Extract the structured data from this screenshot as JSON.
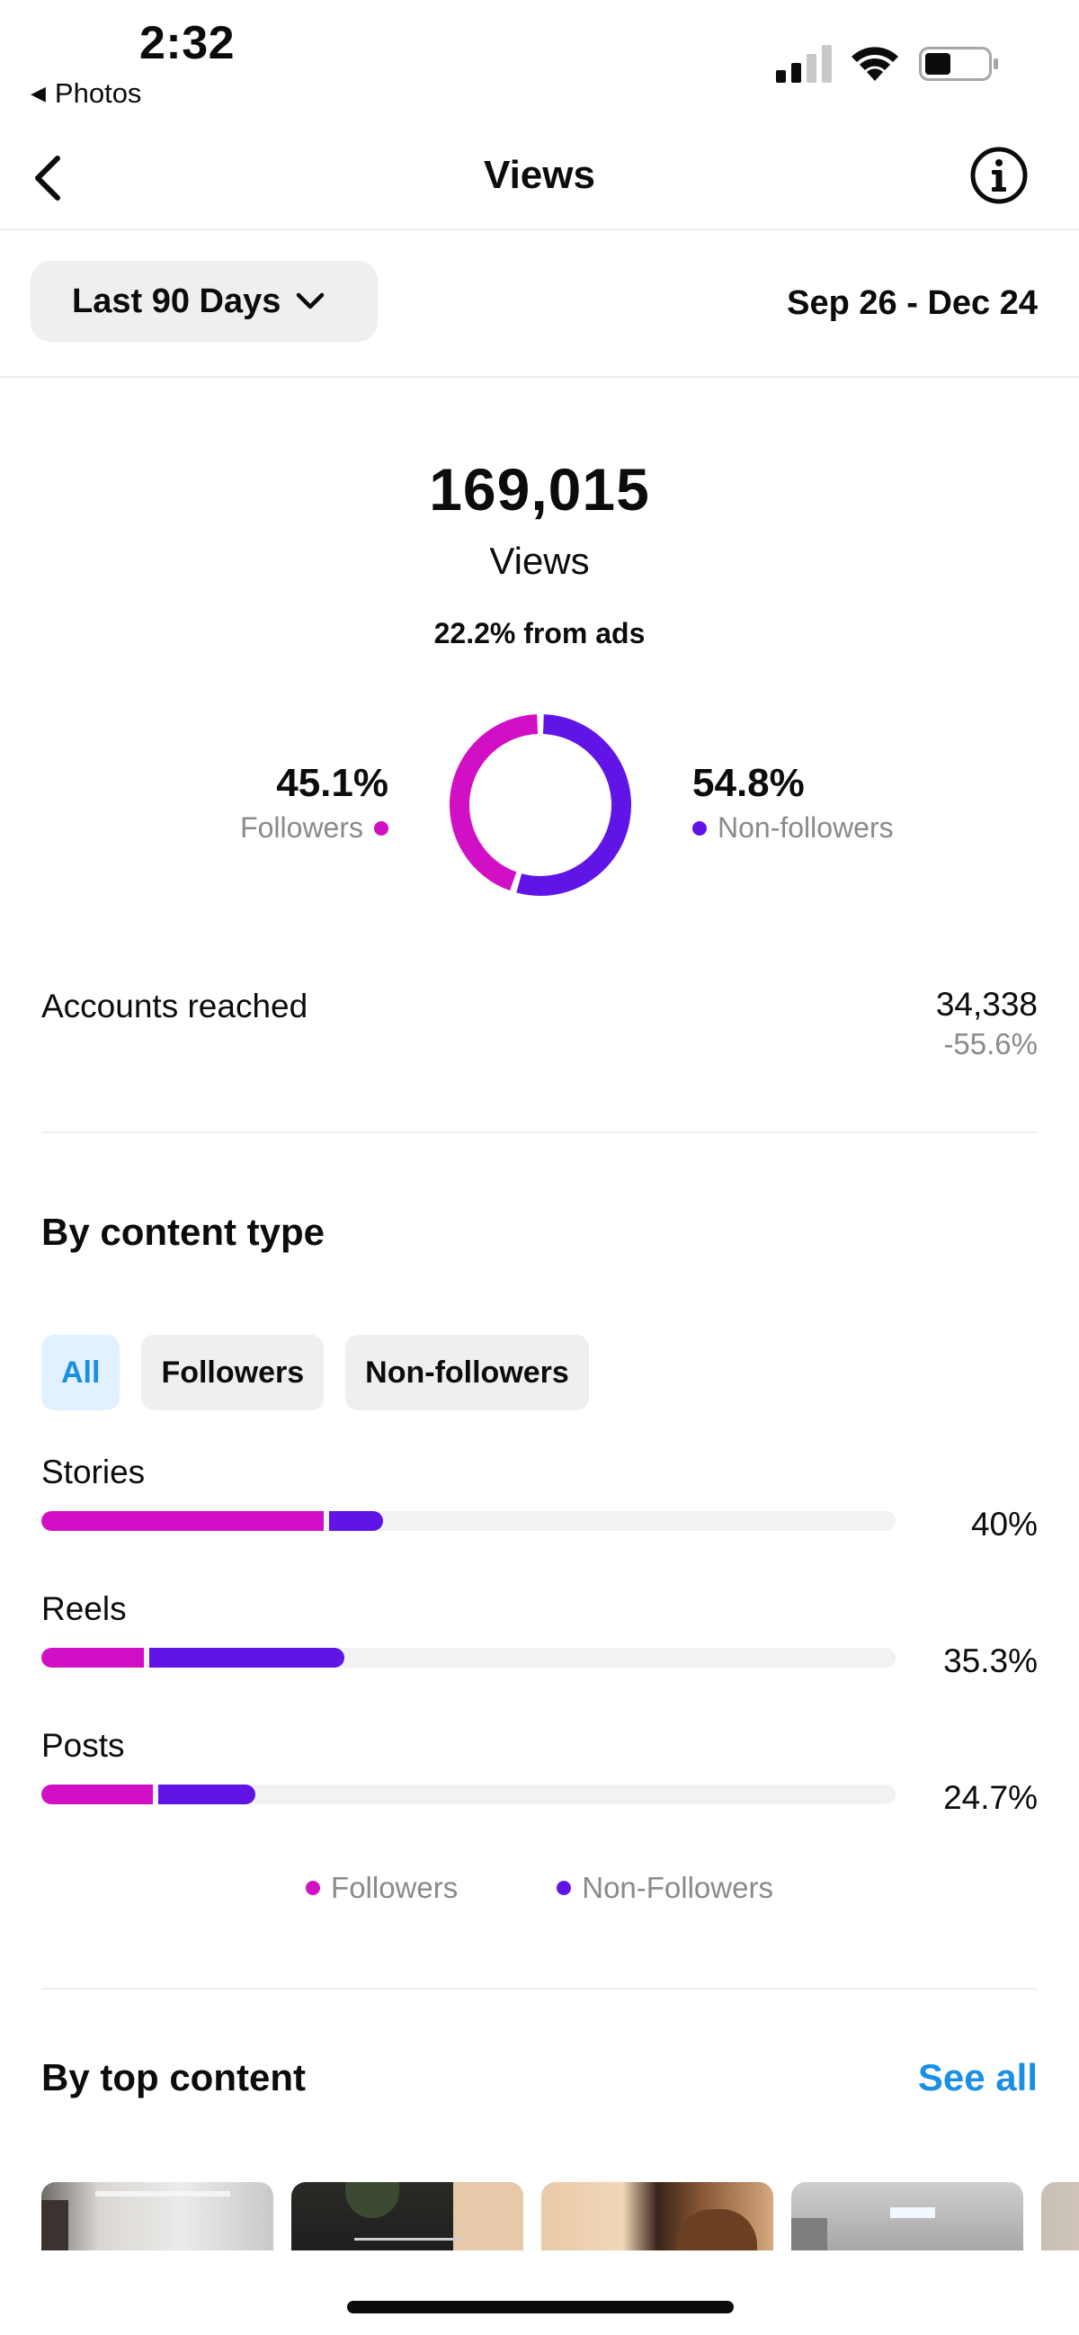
{
  "status_bar": {
    "time": "2:32",
    "back_app": "Photos"
  },
  "header": {
    "title": "Views"
  },
  "filter": {
    "range_label": "Last 90 Days",
    "date_range": "Sep 26 - Dec 24"
  },
  "summary": {
    "total": "169,015",
    "total_label": "Views",
    "ads_note": "22.2% from ads",
    "followers_pct": "45.1%",
    "followers_label": "Followers",
    "non_followers_pct": "54.8%",
    "non_followers_label": "Non-followers",
    "followers_share": 0.451,
    "non_followers_share": 0.548
  },
  "accounts_reached": {
    "label": "Accounts reached",
    "value": "34,338",
    "change": "-55.6%"
  },
  "by_content_type": {
    "title": "By content type",
    "chips": [
      "All",
      "Followers",
      "Non-followers"
    ],
    "active_chip": "All",
    "rows": [
      {
        "label": "Stories",
        "value": "40%",
        "followers_share": 0.33,
        "non_followers_share": 0.07
      },
      {
        "label": "Reels",
        "value": "35.3%",
        "followers_share": 0.12,
        "non_followers_share": 0.235
      },
      {
        "label": "Posts",
        "value": "24.7%",
        "followers_share": 0.13,
        "non_followers_share": 0.12
      }
    ],
    "legend": [
      "Followers",
      "Non-Followers"
    ]
  },
  "by_top_content": {
    "title": "By top content",
    "see_all": "See all"
  },
  "colors": {
    "followers": "#d10fc4",
    "non_followers": "#6015e6",
    "link": "#1a8fe3"
  }
}
